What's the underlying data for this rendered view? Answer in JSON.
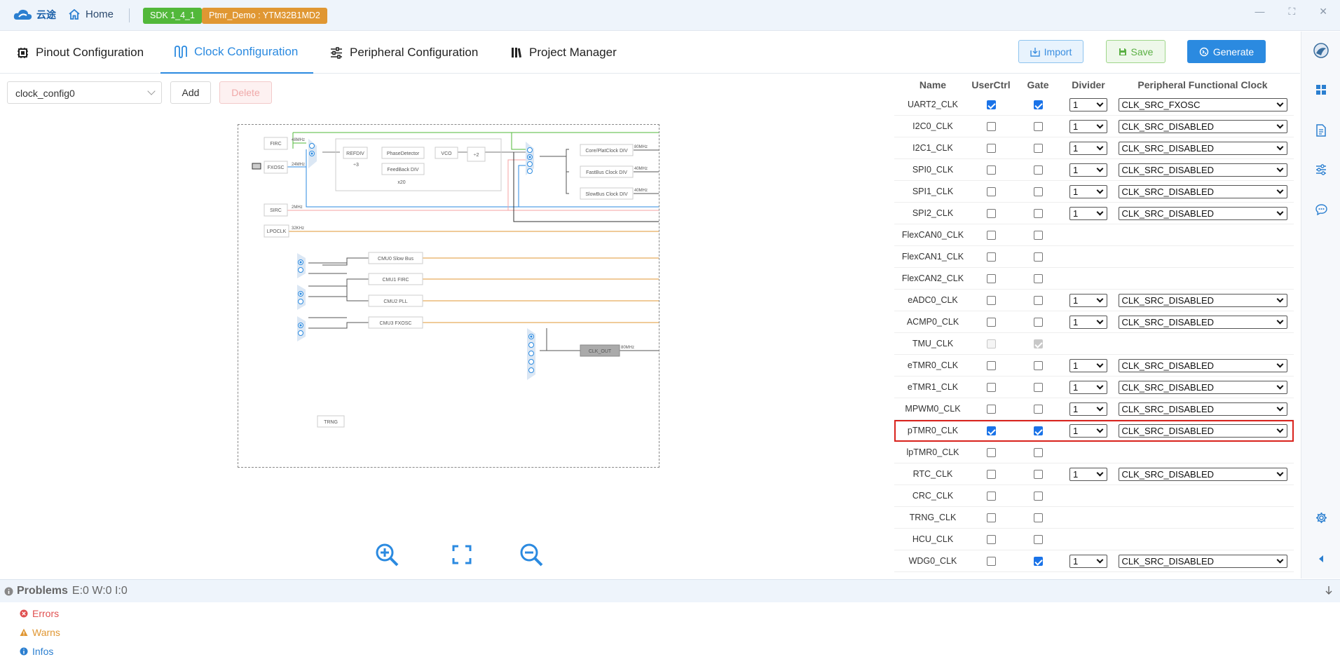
{
  "app": {
    "logo_text": "云途",
    "home": "Home",
    "sdk_badge": "SDK 1_4_1",
    "project_badge": "Ptmr_Demo : YTM32B1MD2"
  },
  "tabs": [
    {
      "label": "Pinout Configuration",
      "icon": "chip-icon"
    },
    {
      "label": "Clock Configuration",
      "icon": "wave-icon"
    },
    {
      "label": "Peripheral Configuration",
      "icon": "sliders-icon"
    },
    {
      "label": "Project Manager",
      "icon": "book-icon"
    }
  ],
  "toolbar": {
    "import": "Import",
    "save": "Save",
    "generate": "Generate"
  },
  "config": {
    "selected": "clock_config0",
    "add": "Add",
    "delete": "Delete"
  },
  "diagram": {
    "blocks": [
      "FIRC",
      "FXOSC",
      "SIRC",
      "LPOCLK",
      "REFDIV",
      "PhaseDetector",
      "VCO",
      "FeedBack DIV",
      "Core/PlatClock DIV",
      "FastBus Clock DIV",
      "SlowBus Clock DIV",
      "CMU0 Slow Bus",
      "CMU1 FIRC",
      "CMU2 PLL",
      "CMU3 FXOSC",
      "CLK_OUT",
      "TRNG"
    ],
    "freqs": [
      "48MHz",
      "24MHz",
      "2MHz",
      "32KHz",
      "80MHz",
      "40MHz",
      "40MHz",
      "80MHz"
    ],
    "misc": [
      "÷3",
      "x20",
      "÷2"
    ]
  },
  "table": {
    "headers": {
      "name": "Name",
      "userctrl": "UserCtrl",
      "gate": "Gate",
      "divider": "Divider",
      "pfc": "Peripheral Functional Clock"
    },
    "rows": [
      {
        "name": "UART2_CLK",
        "uc": true,
        "gate": true,
        "div": "1",
        "pfc": "CLK_SRC_FXOSC"
      },
      {
        "name": "I2C0_CLK",
        "uc": false,
        "gate": false,
        "div": "1",
        "pfc": "CLK_SRC_DISABLED"
      },
      {
        "name": "I2C1_CLK",
        "uc": false,
        "gate": false,
        "div": "1",
        "pfc": "CLK_SRC_DISABLED"
      },
      {
        "name": "SPI0_CLK",
        "uc": false,
        "gate": false,
        "div": "1",
        "pfc": "CLK_SRC_DISABLED"
      },
      {
        "name": "SPI1_CLK",
        "uc": false,
        "gate": false,
        "div": "1",
        "pfc": "CLK_SRC_DISABLED"
      },
      {
        "name": "SPI2_CLK",
        "uc": false,
        "gate": false,
        "div": "1",
        "pfc": "CLK_SRC_DISABLED"
      },
      {
        "name": "FlexCAN0_CLK",
        "uc": false,
        "gate": false,
        "div": null,
        "pfc": null
      },
      {
        "name": "FlexCAN1_CLK",
        "uc": false,
        "gate": false,
        "div": null,
        "pfc": null
      },
      {
        "name": "FlexCAN2_CLK",
        "uc": false,
        "gate": false,
        "div": null,
        "pfc": null
      },
      {
        "name": "eADC0_CLK",
        "uc": false,
        "gate": false,
        "div": "1",
        "pfc": "CLK_SRC_DISABLED"
      },
      {
        "name": "ACMP0_CLK",
        "uc": false,
        "gate": false,
        "div": "1",
        "pfc": "CLK_SRC_DISABLED"
      },
      {
        "name": "TMU_CLK",
        "uc": false,
        "gate": true,
        "disabled": true,
        "div": null,
        "pfc": null
      },
      {
        "name": "eTMR0_CLK",
        "uc": false,
        "gate": false,
        "div": "1",
        "pfc": "CLK_SRC_DISABLED"
      },
      {
        "name": "eTMR1_CLK",
        "uc": false,
        "gate": false,
        "div": "1",
        "pfc": "CLK_SRC_DISABLED"
      },
      {
        "name": "MPWM0_CLK",
        "uc": false,
        "gate": false,
        "div": "1",
        "pfc": "CLK_SRC_DISABLED"
      },
      {
        "name": "pTMR0_CLK",
        "uc": true,
        "gate": true,
        "div": "1",
        "pfc": "CLK_SRC_DISABLED",
        "highlight": true
      },
      {
        "name": "lpTMR0_CLK",
        "uc": false,
        "gate": false,
        "div": null,
        "pfc": null
      },
      {
        "name": "RTC_CLK",
        "uc": false,
        "gate": false,
        "div": "1",
        "pfc": "CLK_SRC_DISABLED"
      },
      {
        "name": "CRC_CLK",
        "uc": false,
        "gate": false,
        "div": null,
        "pfc": null
      },
      {
        "name": "TRNG_CLK",
        "uc": false,
        "gate": false,
        "div": null,
        "pfc": null
      },
      {
        "name": "HCU_CLK",
        "uc": false,
        "gate": false,
        "div": null,
        "pfc": null
      },
      {
        "name": "WDG0_CLK",
        "uc": false,
        "gate": true,
        "div": "1",
        "pfc": "CLK_SRC_DISABLED"
      }
    ]
  },
  "problems": {
    "title": "Problems",
    "counts": "E:0 W:0 I:0",
    "errors": "Errors",
    "warns": "Warns",
    "infos": "Infos"
  },
  "colors": {
    "accent": "#2b8ae0",
    "sdk": "#52b83a",
    "project": "#e09733",
    "highlight": "#d9221c"
  }
}
